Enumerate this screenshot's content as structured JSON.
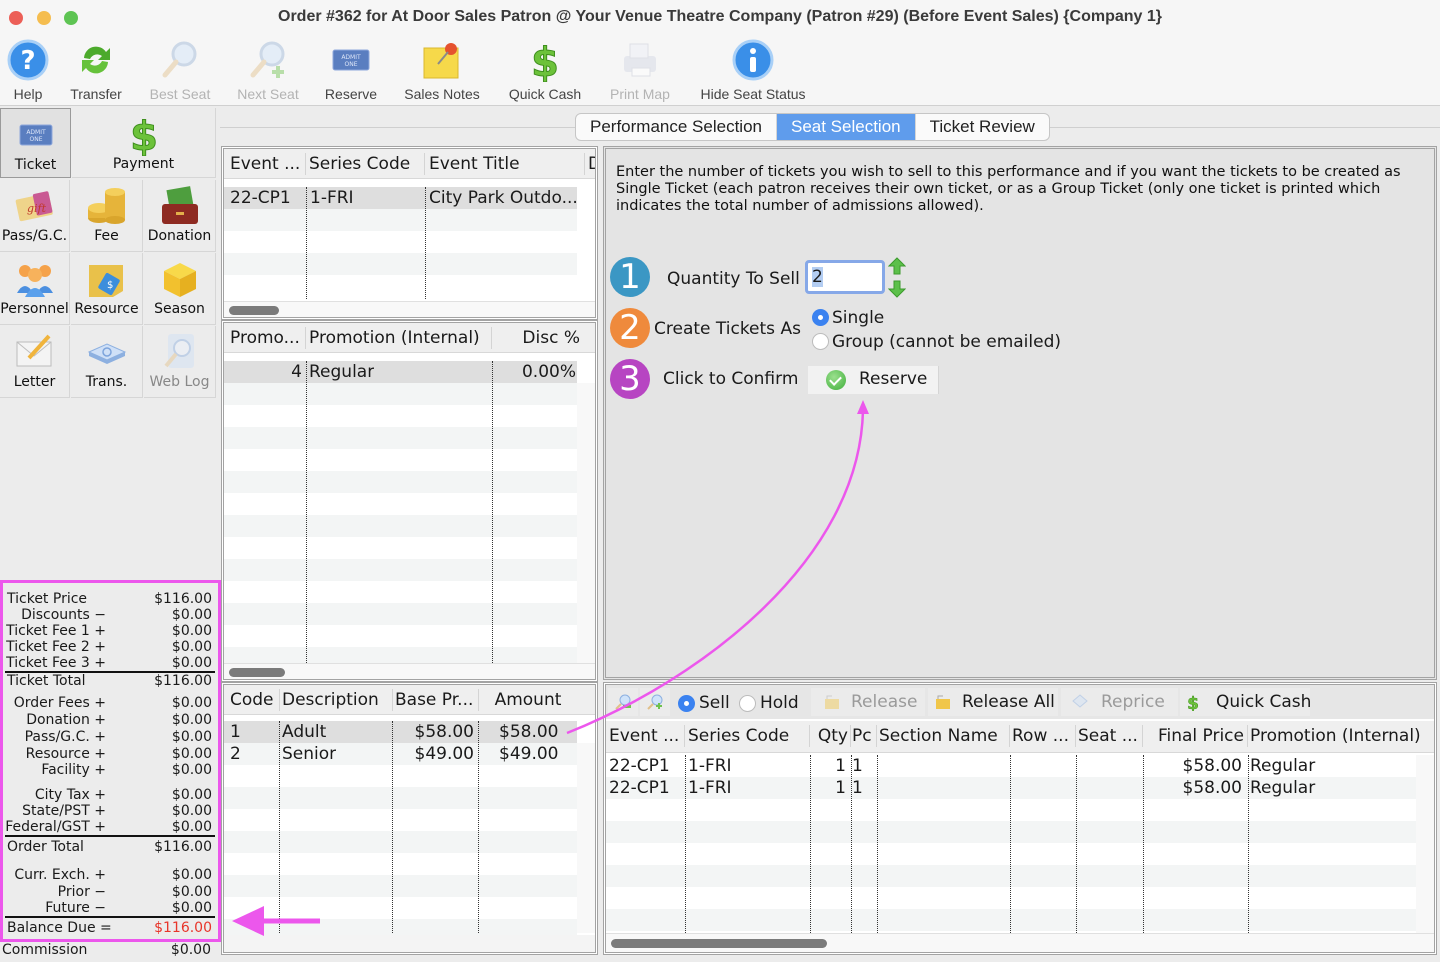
{
  "window": {
    "title": "Order #362 for At Door Sales Patron @ Your Venue Theatre Company (Patron #29) (Before Event Sales) {Company 1}"
  },
  "toolbar": {
    "items": [
      {
        "label": "Help",
        "icon": "help-icon",
        "enabled": true
      },
      {
        "label": "Transfer",
        "icon": "transfer-icon",
        "enabled": true
      },
      {
        "label": "Best Seat",
        "icon": "magnifier-icon",
        "enabled": false
      },
      {
        "label": "Next Seat",
        "icon": "magnifier-plus-icon",
        "enabled": false
      },
      {
        "label": "Reserve",
        "icon": "ticket-icon",
        "enabled": true
      },
      {
        "label": "Sales Notes",
        "icon": "note-pin-icon",
        "enabled": true
      },
      {
        "label": "Quick Cash",
        "icon": "dollar-icon",
        "enabled": true
      },
      {
        "label": "Print Map",
        "icon": "printer-icon",
        "enabled": false
      },
      {
        "label": "Hide Seat Status",
        "icon": "info-icon",
        "enabled": true
      }
    ]
  },
  "sidebar": {
    "items": [
      {
        "label": "Ticket",
        "icon": "ticket-icon",
        "selected": true
      },
      {
        "label": "Payment",
        "icon": "dollar-icon"
      },
      {
        "label": "Pass/G.C.",
        "icon": "gift-card-icon"
      },
      {
        "label": "Fee",
        "icon": "coins-icon"
      },
      {
        "label": "Donation",
        "icon": "money-wallet-icon"
      },
      {
        "label": "Personnel",
        "icon": "people-icon"
      },
      {
        "label": "Resource",
        "icon": "resource-folder-icon"
      },
      {
        "label": "Season",
        "icon": "box-icon"
      },
      {
        "label": "Letter",
        "icon": "letter-pencil-icon"
      },
      {
        "label": "Trans.",
        "icon": "transaction-icon"
      },
      {
        "label": "Web Log",
        "icon": "web-log-icon",
        "enabled": false
      }
    ]
  },
  "summary": {
    "rows": [
      {
        "label": "Ticket Price",
        "value": "$116.00"
      },
      {
        "label": "Discounts −",
        "value": "$0.00"
      },
      {
        "label": "Ticket Fee 1 +",
        "value": "$0.00"
      },
      {
        "label": "Ticket Fee 2 +",
        "value": "$0.00"
      },
      {
        "label": "Ticket Fee 3 +",
        "value": "$0.00"
      },
      {
        "label": "Ticket Total",
        "value": "$116.00"
      },
      {
        "label": "Order Fees +",
        "value": "$0.00"
      },
      {
        "label": "Donation +",
        "value": "$0.00"
      },
      {
        "label": "Pass/G.C. +",
        "value": "$0.00"
      },
      {
        "label": "Resource +",
        "value": "$0.00"
      },
      {
        "label": "Facility +",
        "value": "$0.00"
      },
      {
        "label": "City Tax +",
        "value": "$0.00"
      },
      {
        "label": "State/PST +",
        "value": "$0.00"
      },
      {
        "label": "Federal/GST +",
        "value": "$0.00"
      },
      {
        "label": "Order Total",
        "value": "$116.00"
      },
      {
        "label": "Curr. Exch. +",
        "value": "$0.00"
      },
      {
        "label": "Prior −",
        "value": "$0.00"
      },
      {
        "label": "Future −",
        "value": "$0.00"
      },
      {
        "label": "Balance Due =",
        "value": "$116.00"
      }
    ],
    "commission": {
      "label": "Commission",
      "value": "$0.00"
    },
    "balance_color": "#e8352a",
    "highlight_color": "#ec57ec"
  },
  "tabs": [
    {
      "label": "Performance Selection",
      "active": false
    },
    {
      "label": "Seat Selection",
      "active": true
    },
    {
      "label": "Ticket Review",
      "active": false
    }
  ],
  "events_table": {
    "columns": [
      "Event ...",
      "Series Code",
      "Event Title",
      "D"
    ],
    "rows": [
      [
        "22-CP1",
        "1-FRI",
        "City Park Outdo..."
      ]
    ]
  },
  "promotions_table": {
    "columns": [
      "Promo...",
      "Promotion (Internal)",
      "Disc %"
    ],
    "rows": [
      [
        "4",
        "Regular",
        "0.00%"
      ]
    ]
  },
  "prices_table": {
    "columns": [
      "Code",
      "Description",
      "Base Pr...",
      "Amount"
    ],
    "rows": [
      [
        "1",
        "Adult",
        "$58.00",
        "$58.00"
      ],
      [
        "2",
        "Senior",
        "$49.00",
        "$49.00"
      ]
    ]
  },
  "seat_selection": {
    "instructions": "Enter the number of tickets you wish to sell to this performance and if you want the tickets to be created as Single Ticket (each patron receives their own ticket, or as a Group Ticket (only one ticket is printed which indicates the total number of admissions allowed).",
    "step1": {
      "number": "1",
      "label": "Quantity To Sell",
      "value": "2",
      "color": "#3b97c4"
    },
    "step2": {
      "number": "2",
      "label": "Create Tickets As",
      "color": "#ef8a3c",
      "options": [
        {
          "label": "Single",
          "selected": true
        },
        {
          "label": "Group (cannot be emailed)",
          "selected": false
        }
      ]
    },
    "step3": {
      "number": "3",
      "label": "Click to Confirm",
      "button": "Reserve",
      "color": "#b745c2"
    }
  },
  "cart": {
    "toolbar": {
      "mode_options": [
        {
          "label": "Sell",
          "selected": true
        },
        {
          "label": "Hold",
          "selected": false
        }
      ],
      "release": "Release",
      "release_all": "Release All",
      "reprice": "Reprice",
      "quick_cash": "Quick Cash"
    },
    "columns": [
      "Event ...",
      "Series Code",
      "Qty",
      "Pc",
      "Section Name",
      "Row ...",
      "Seat ...",
      "Final Price",
      "Promotion (Internal)"
    ],
    "rows": [
      [
        "22-CP1",
        "1-FRI",
        "1",
        "1",
        "",
        "",
        "",
        "$58.00",
        "Regular"
      ],
      [
        "22-CP1",
        "1-FRI",
        "1",
        "1",
        "",
        "",
        "",
        "$58.00",
        "Regular"
      ]
    ]
  }
}
